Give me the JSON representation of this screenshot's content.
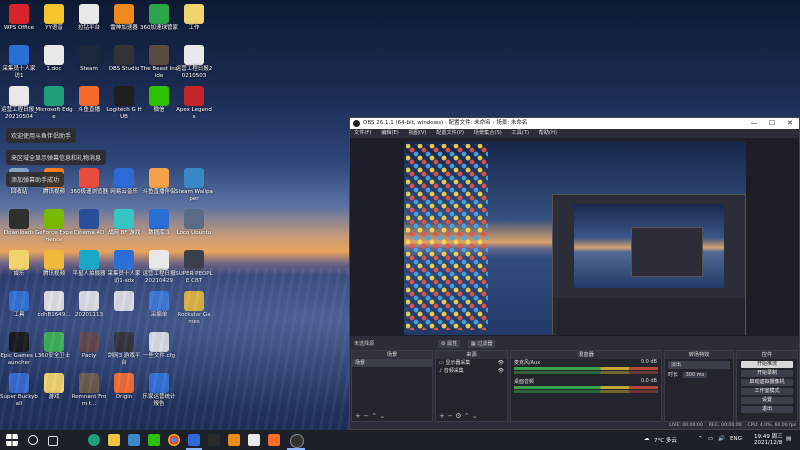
{
  "desktop": {
    "icons": [
      {
        "label": "WPS Office",
        "color": "#d8232a",
        "col": 0,
        "row": 0
      },
      {
        "label": "YY语音",
        "color": "#f6c52e",
        "col": 1,
        "row": 0
      },
      {
        "label": "拉钻平台",
        "color": "#e8e8e8",
        "col": 2,
        "row": 0
      },
      {
        "label": "雷神加速器",
        "color": "#f08a1c",
        "col": 3,
        "row": 0
      },
      {
        "label": "360加速球管家",
        "color": "#2ca44a",
        "col": 4,
        "row": 0
      },
      {
        "label": "工作",
        "color": "#f1d36e",
        "col": 5,
        "row": 0
      },
      {
        "label": "采集员十人家访1",
        "color": "#2b6fd6",
        "col": 0,
        "row": 1
      },
      {
        "label": "1.doc",
        "color": "#e8e8e8",
        "col": 1,
        "row": 1
      },
      {
        "label": "Steam",
        "color": "#1b2838",
        "col": 2,
        "row": 1
      },
      {
        "label": "OBS Studio",
        "color": "#333333",
        "col": 3,
        "row": 1
      },
      {
        "label": "The Beast Inside",
        "color": "#5a4b3e",
        "col": 4,
        "row": 1
      },
      {
        "label": "运营工程日报20210503",
        "color": "#e8e8e8",
        "col": 5,
        "row": 1
      },
      {
        "label": "运营工程日报_20210504",
        "color": "#e8e8e8",
        "col": 0,
        "row": 2
      },
      {
        "label": "Microsoft Edge",
        "color": "#1f9e7a",
        "col": 1,
        "row": 2
      },
      {
        "label": "斗鱼直播",
        "color": "#f36c2b",
        "col": 2,
        "row": 2
      },
      {
        "label": "Logitech G HUB",
        "color": "#1e1e1e",
        "col": 3,
        "row": 2
      },
      {
        "label": "微信",
        "color": "#2dc100",
        "col": 4,
        "row": 2
      },
      {
        "label": "Apex Legends",
        "color": "#c3242a",
        "col": 5,
        "row": 2
      },
      {
        "label": "回收站",
        "color": "#8aa0c0",
        "col": 0,
        "row": 4
      },
      {
        "label": "腾讯视频",
        "color": "#ff7d1d",
        "col": 1,
        "row": 4
      },
      {
        "label": "360极速浏览器",
        "color": "#e94b3c",
        "col": 2,
        "row": 4
      },
      {
        "label": "网易云音乐",
        "color": "#2c6ad8",
        "col": 3,
        "row": 4
      },
      {
        "label": "斗鱼直播伴侣",
        "color": "#f4a14a",
        "col": 4,
        "row": 4
      },
      {
        "label": "Steam Wallpaper",
        "color": "#3a87c8",
        "col": 5,
        "row": 4
      },
      {
        "label": "Downloads",
        "color": "#2f2f2f",
        "col": 0,
        "row": 5
      },
      {
        "label": "GeForce Experience",
        "color": "#76b900",
        "col": 1,
        "row": 5
      },
      {
        "label": "Cinema 4D",
        "color": "#2a4e9a",
        "col": 2,
        "row": 5
      },
      {
        "label": "战网 BF 游戏",
        "color": "#36c4c4",
        "col": 3,
        "row": 5
      },
      {
        "label": "数据库 1",
        "color": "#2b6fd6",
        "col": 4,
        "row": 5
      },
      {
        "label": "Loco Ubuntu",
        "color": "#5b6b86",
        "col": 5,
        "row": 5
      },
      {
        "label": "娱乐",
        "color": "#f1d36e",
        "col": 0,
        "row": 6
      },
      {
        "label": "腾讯视频",
        "color": "#f1b93a",
        "col": 1,
        "row": 6
      },
      {
        "label": "平星人拍摄器",
        "color": "#1aa8c8",
        "col": 2,
        "row": 6
      },
      {
        "label": "采集员十人家访1-sdx",
        "color": "#2b6fd6",
        "col": 3,
        "row": 6
      },
      {
        "label": "运营工程日报 20210429",
        "color": "#e8e8e8",
        "col": 4,
        "row": 6
      },
      {
        "label": "SUPER PEOPLE CBT",
        "color": "#3b3f4b",
        "col": 5,
        "row": 6
      },
      {
        "label": "工具",
        "color": "#2b6fd6",
        "col": 0,
        "row": 7
      },
      {
        "label": "cdhB1649...",
        "color": "#e8e8e8",
        "col": 1,
        "row": 7
      },
      {
        "label": "20201113",
        "color": "#e8e8e8",
        "col": 2,
        "row": 7
      },
      {
        "label": "",
        "color": "#e8e8e8",
        "col": 3,
        "row": 7
      },
      {
        "label": "采编单",
        "color": "#2b6fd6",
        "col": 4,
        "row": 7
      },
      {
        "label": "Rockstar Games",
        "color": "#f0b81c",
        "col": 5,
        "row": 7
      },
      {
        "label": "Epic Games Launcher",
        "color": "#111111",
        "col": 0,
        "row": 8
      },
      {
        "label": "360安全卫士",
        "color": "#33b24a",
        "col": 1,
        "row": 8
      },
      {
        "label": "Paciy",
        "color": "#5a3b3b",
        "col": 2,
        "row": 8
      },
      {
        "label": "剑网3 游戏平台",
        "color": "#222222",
        "col": 3,
        "row": 8
      },
      {
        "label": "一些文件.cfg",
        "color": "#e8e8e8",
        "col": 4,
        "row": 8
      },
      {
        "label": "Super Buckyball",
        "color": "#3a6ad0",
        "col": 0,
        "row": 9
      },
      {
        "label": "游戏",
        "color": "#f1d36e",
        "col": 1,
        "row": 9
      },
      {
        "label": "Remnant From t...",
        "color": "#6b5a48",
        "col": 2,
        "row": 9
      },
      {
        "label": "Origin",
        "color": "#f56c2d",
        "col": 3,
        "row": 9
      },
      {
        "label": "乐家运营统计报告",
        "color": "#2b6fd6",
        "col": 4,
        "row": 9
      }
    ],
    "tooltips": [
      {
        "text": "欢迎使用斗鱼伴侣助手"
      },
      {
        "text": "来区域全显示弹幕信息和礼物消息"
      },
      {
        "text": "添加弹幕助手成功"
      }
    ]
  },
  "obs": {
    "title": "OBS 26.1.1 (64-bit, windows) - 配置文件: 未命名 - 场景: 未命名",
    "menu": [
      "文件(F)",
      "编辑(E)",
      "视图(V)",
      "配置文件(P)",
      "场景集合(S)",
      "工具(T)",
      "帮助(H)"
    ],
    "mode_label": "未选择源",
    "preview_tab_labels": [
      "属性",
      "过滤器"
    ],
    "panels": {
      "scenes": {
        "header": "场景",
        "items": [
          "场景"
        ]
      },
      "sources": {
        "header": "来源",
        "items": [
          "显示器采集",
          "音频采集"
        ]
      },
      "mixer": {
        "header": "混音器",
        "channels": [
          {
            "name": "麦克风/Aux",
            "db": "0.0 dB"
          },
          {
            "name": "桌面音频",
            "db": "0.0 dB"
          }
        ]
      },
      "transitions": {
        "header": "转场特效",
        "type": "淡出",
        "duration_label": "时长",
        "duration": "300 ms"
      },
      "controls": {
        "header": "控件",
        "buttons": [
          "开始推流",
          "开始录制",
          "启动虚拟摄像机",
          "工作室模式",
          "设置",
          "退出"
        ]
      }
    },
    "status": {
      "live": "LIVE: 00:00:00",
      "rec": "REC: 00:00:00",
      "cpu": "CPU: 4.0%, 60.00 fps"
    }
  },
  "taskbar": {
    "weather": "7°C 多云",
    "lang": "ENG",
    "time": "19:49 周三",
    "date": "2021/12/8"
  }
}
